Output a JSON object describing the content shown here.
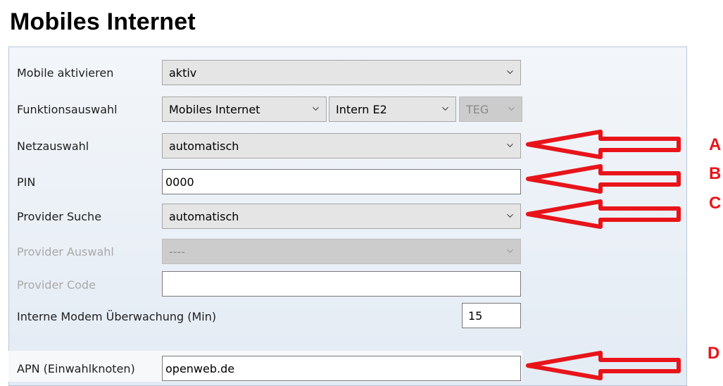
{
  "title": "Mobiles Internet",
  "fields": {
    "mobile_aktivieren": {
      "label": "Mobile aktivieren",
      "value": "aktiv"
    },
    "funktionsauswahl": {
      "label": "Funktionsauswahl",
      "value1": "Mobiles Internet",
      "value2": "Intern E2",
      "value3": "TEG"
    },
    "netzauswahl": {
      "label": "Netzauswahl",
      "value": "automatisch"
    },
    "pin": {
      "label": "PIN",
      "value": "0000"
    },
    "provider_suche": {
      "label": "Provider Suche",
      "value": "automatisch"
    },
    "provider_auswahl": {
      "label": "Provider Auswahl",
      "value": "----"
    },
    "provider_code": {
      "label": "Provider Code",
      "value": ""
    },
    "modem_ueberwachung": {
      "label": "Interne Modem Überwachung (Min)",
      "value": "15"
    },
    "apn": {
      "label": "APN (Einwahlknoten)",
      "value": "openweb.de"
    }
  },
  "annotations": {
    "a": "A",
    "b": "B",
    "c": "C",
    "d": "D",
    "color": "#e8141a"
  },
  "colors": {
    "panel_border": "#b9c6d6",
    "select_bg": "#e5e5e5",
    "disabled_bg": "#cccccc"
  }
}
